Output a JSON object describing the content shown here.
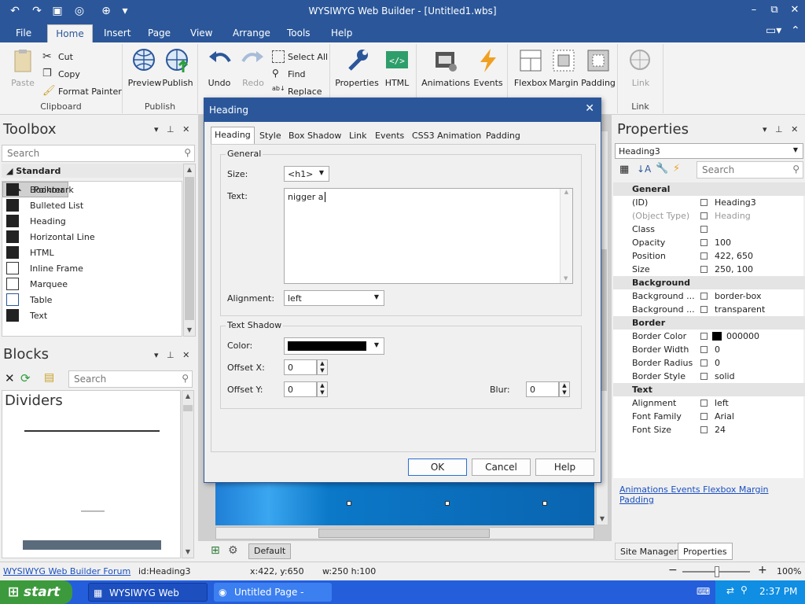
{
  "window": {
    "title": "WYSIWYG Web Builder - [Untitled1.wbs]",
    "minimize": "–",
    "restore": "⧉",
    "close": "✕"
  },
  "menu": {
    "tabs": [
      "File",
      "Home",
      "Insert",
      "Page",
      "View",
      "Arrange",
      "Tools",
      "Help"
    ],
    "active": "Home"
  },
  "ribbon": {
    "clipboard": {
      "label": "Clipboard",
      "paste": "Paste",
      "cut": "Cut",
      "copy": "Copy",
      "format_painter": "Format Painter"
    },
    "publish": {
      "label": "Publish",
      "preview": "Preview",
      "publish": "Publish"
    },
    "edit": {
      "undo": "Undo",
      "redo": "Redo",
      "select_all": "Select All",
      "find": "Find",
      "replace": "Replace"
    },
    "props": {
      "properties": "Properties",
      "html": "HTML"
    },
    "anim": {
      "animations": "Animations",
      "events": "Events"
    },
    "layout": {
      "flexbox": "Flexbox",
      "margin": "Margin",
      "padding": "Padding"
    },
    "link": {
      "label": "Link",
      "link": "Link"
    }
  },
  "toolbox": {
    "title": "Toolbox",
    "search_placeholder": "Search",
    "category": "Standard",
    "items": [
      "Pointer",
      "Bookmark",
      "Bulleted List",
      "Heading",
      "Horizontal Line",
      "HTML",
      "Inline Frame",
      "Marquee",
      "Table",
      "Text"
    ]
  },
  "blocks": {
    "title": "Blocks",
    "search_placeholder": "Search",
    "section": "Dividers"
  },
  "dialog": {
    "title": "Heading",
    "close": "✕",
    "tabs": [
      "Heading",
      "Style",
      "Box Shadow",
      "Link",
      "Events",
      "CSS3 Animation",
      "Padding"
    ],
    "general_legend": "General",
    "size_label": "Size:",
    "size_value": "<h1>",
    "text_label": "Text:",
    "text_value": "nigger a",
    "alignment_label": "Alignment:",
    "alignment_value": "left",
    "shadow_legend": "Text Shadow",
    "color_label": "Color:",
    "offsetx_label": "Offset X:",
    "offsetx_value": "0",
    "offsety_label": "Offset Y:",
    "offsety_value": "0",
    "blur_label": "Blur:",
    "blur_value": "0",
    "ok": "OK",
    "cancel": "Cancel",
    "help": "Help"
  },
  "properties": {
    "title": "Properties",
    "object": "Heading3",
    "search_placeholder": "Search",
    "rows": [
      {
        "cat": true,
        "name": "General"
      },
      {
        "name": "(ID)",
        "value": "Heading3"
      },
      {
        "name": "(Object Type)",
        "value": "Heading",
        "dim": true
      },
      {
        "name": "Class",
        "value": ""
      },
      {
        "name": "Opacity",
        "value": "100"
      },
      {
        "name": "Position",
        "value": "422, 650"
      },
      {
        "name": "Size",
        "value": "250, 100"
      },
      {
        "cat": true,
        "name": "Background"
      },
      {
        "name": "Background ...",
        "value": "border-box"
      },
      {
        "name": "Background ...",
        "value": "transparent"
      },
      {
        "cat": true,
        "name": "Border"
      },
      {
        "name": "Border Color",
        "value": "000000",
        "swatch": "#000000"
      },
      {
        "name": "Border Width",
        "value": "0"
      },
      {
        "name": "Border Radius",
        "value": "0"
      },
      {
        "name": "Border Style",
        "value": "solid"
      },
      {
        "cat": true,
        "name": "Text"
      },
      {
        "name": "Alignment",
        "value": "left"
      },
      {
        "name": "Font Family",
        "value": "Arial"
      },
      {
        "name": "Font Size",
        "value": "24"
      }
    ],
    "links": [
      "Animations",
      "Events",
      "Flexbox",
      "Margin",
      "Padding"
    ],
    "bottom_tabs": [
      "Site Manager",
      "Properties"
    ]
  },
  "workspace": {
    "page_tab": "Default"
  },
  "status": {
    "forum": "WYSIWYG Web Builder Forum",
    "id": "id:Heading3",
    "pos": "x:422, y:650",
    "size": "w:250 h:100",
    "zoom": "100%"
  },
  "taskbar": {
    "start": "start",
    "items": [
      "WYSIWYG Web Build...",
      "Untitled Page - Mypal"
    ],
    "time": "2:37 PM"
  },
  "colors": {
    "accent": "#2b579a",
    "taskbar": "#245edb",
    "start": "#3c9a3c"
  }
}
